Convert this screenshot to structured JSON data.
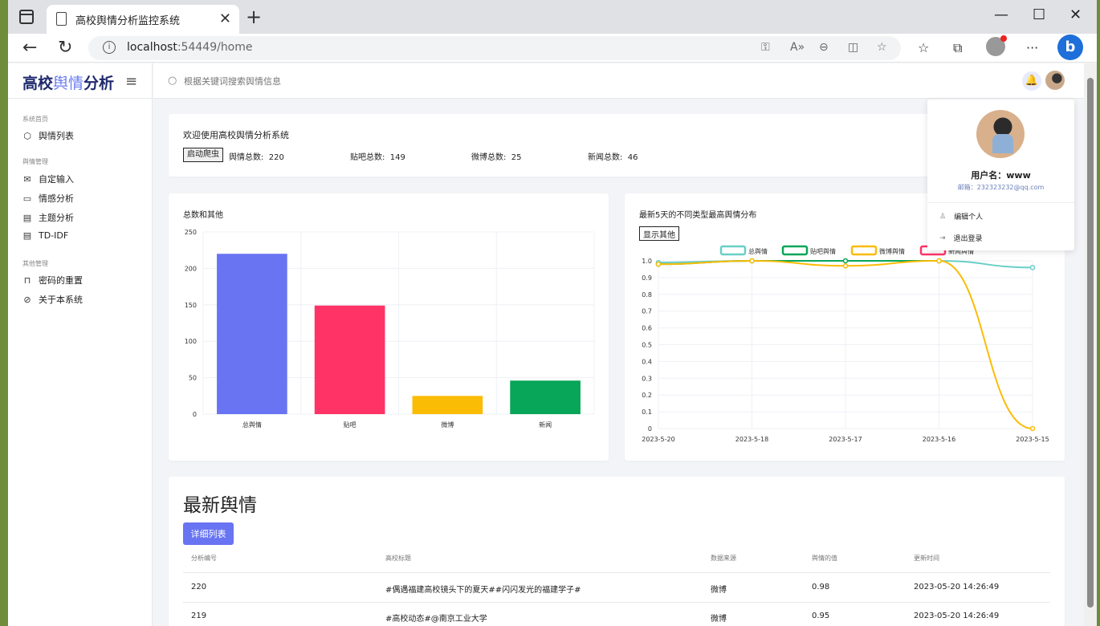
{
  "browser": {
    "tab_title": "高校舆情分析监控系统",
    "url_host": "localhost",
    "url_rest": ":54449/home"
  },
  "sidebar": {
    "logo_main": "高校",
    "logo_light": "舆情",
    "logo_end": "分析",
    "groups": [
      {
        "title": "系统首页",
        "items": [
          {
            "label": "舆情列表",
            "icon": "cube-icon"
          }
        ]
      },
      {
        "title": "舆情管理",
        "items": [
          {
            "label": "自定输入",
            "icon": "mail-icon"
          },
          {
            "label": "情感分析",
            "icon": "chat-icon"
          },
          {
            "label": "主题分析",
            "icon": "calendar-icon"
          },
          {
            "label": "TD-IDF",
            "icon": "calendar-icon"
          }
        ]
      },
      {
        "title": "其他管理",
        "items": [
          {
            "label": "密码的重置",
            "icon": "lock-icon"
          },
          {
            "label": "关于本系统",
            "icon": "eye-off-icon"
          }
        ]
      }
    ]
  },
  "topbar": {
    "search_placeholder": "根据关键词搜索舆情信息"
  },
  "welcome": {
    "text": "欢迎使用高校舆情分析系统",
    "crawl_button": "启动爬虫",
    "stats": [
      {
        "label": "舆情总数:",
        "value": "220"
      },
      {
        "label": "贴吧总数:",
        "value": "149"
      },
      {
        "label": "微博总数:",
        "value": "25"
      },
      {
        "label": "新闻总数:",
        "value": "46"
      }
    ]
  },
  "chart_data": [
    {
      "type": "bar",
      "title": "总数和其他",
      "categories": [
        "总舆情",
        "贴吧",
        "微博",
        "新闻"
      ],
      "values": [
        220,
        149,
        25,
        46
      ],
      "colors": [
        "#6874f2",
        "#ff3366",
        "#fbbc05",
        "#07a658"
      ],
      "ylim": [
        0,
        250
      ],
      "yticks": [
        0,
        50,
        100,
        150,
        200,
        250
      ],
      "grid": true
    },
    {
      "type": "line",
      "title": "最新5天的不同类型最高舆情分布",
      "button": "显示其他",
      "categories": [
        "2023-5-20",
        "2023-5-18",
        "2023-5-17",
        "2023-5-16",
        "2023-5-15"
      ],
      "ylim": [
        0,
        1.0
      ],
      "yticks": [
        "0",
        "0.1",
        "0.2",
        "0.3",
        "0.4",
        "0.5",
        "0.6",
        "0.7",
        "0.8",
        "0.9",
        "1.0"
      ],
      "legend_position": "top",
      "series": [
        {
          "name": "总舆情",
          "color": "#69cfc7",
          "values": [
            0.99,
            1.0,
            1.0,
            1.0,
            0.96
          ]
        },
        {
          "name": "贴吧舆情",
          "color": "#07a658",
          "values": [
            0.98,
            1.0,
            1.0,
            1.0,
            null
          ]
        },
        {
          "name": "微博舆情",
          "color": "#fbbc05",
          "values": [
            0.98,
            1.0,
            0.97,
            1.0,
            0.0
          ]
        },
        {
          "name": "新闻舆情",
          "color": "#ff3366",
          "values": [
            null,
            null,
            null,
            null,
            null
          ]
        }
      ]
    }
  ],
  "latest": {
    "title": "最新舆情",
    "detail_button": "详细列表",
    "columns": [
      "分析编号",
      "高校标题",
      "数据来源",
      "舆情的值",
      "更新时间"
    ],
    "rows": [
      [
        "220",
        "#偶遇福建高校镜头下的夏天##闪闪发光的福建学子#",
        "微博",
        "0.98",
        "2023-05-20 14:26:49"
      ],
      [
        "219",
        "#高校动态#@南京工业大学",
        "微博",
        "0.95",
        "2023-05-20 14:26:49"
      ]
    ]
  },
  "user_menu": {
    "username": "用户名：www",
    "email": "邮箱：232323232@qq.com",
    "items": [
      {
        "label": "编辑个人",
        "icon": "user-icon"
      },
      {
        "label": "退出登录",
        "icon": "logout-icon"
      }
    ]
  }
}
